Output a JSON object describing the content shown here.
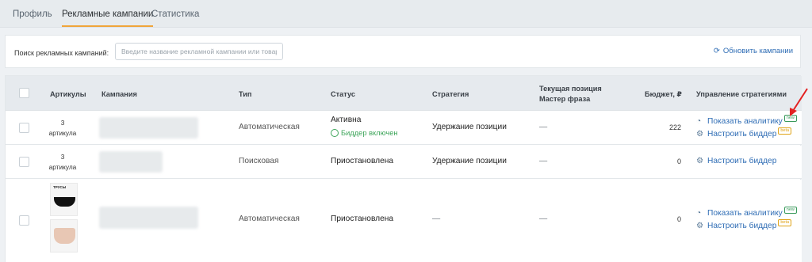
{
  "tabs": [
    "Профиль",
    "Рекламные кампании",
    "Статистика"
  ],
  "search": {
    "label": "Поиск рекламных кампаний:",
    "placeholder": "Введите название рекламной кампании или товар",
    "refresh_label": "Обновить кампании"
  },
  "columns": {
    "articles": "Артикулы",
    "campaign": "Кампания",
    "type": "Тип",
    "status": "Статус",
    "strategy": "Стратегия",
    "position_line1": "Текущая позиция",
    "position_line2": "Мастер фраза",
    "budget": "Бюджет, ₽",
    "manage": "Управление стратегиями"
  },
  "badges": {
    "new": "new",
    "beta": "beta"
  },
  "rows": [
    {
      "articles_count": "3",
      "articles_unit": "артикула",
      "type": "Автоматическая",
      "status": "Активна",
      "bidder": "Биддер включен",
      "strategy": "Удержание позиции",
      "position": "—",
      "budget": "222",
      "analytics_link": "Показать аналитику",
      "bidder_link": "Настроить биддер"
    },
    {
      "articles_count": "3",
      "articles_unit": "артикула",
      "type": "Поисковая",
      "status": "Приостановлена",
      "strategy": "Удержание позиции",
      "position": "—",
      "budget": "0",
      "bidder_link": "Настроить биддер"
    },
    {
      "product_label": "ТРУСЫ",
      "type": "Автоматическая",
      "status": "Приостановлена",
      "strategy": "—",
      "position": "—",
      "budget": "0",
      "analytics_link": "Показать аналитику",
      "bidder_link": "Настроить биддер"
    }
  ],
  "colors": {
    "accent": "#f0a53a",
    "link": "#2f6db5",
    "success": "#3da55a",
    "annotation": "#e32222"
  }
}
